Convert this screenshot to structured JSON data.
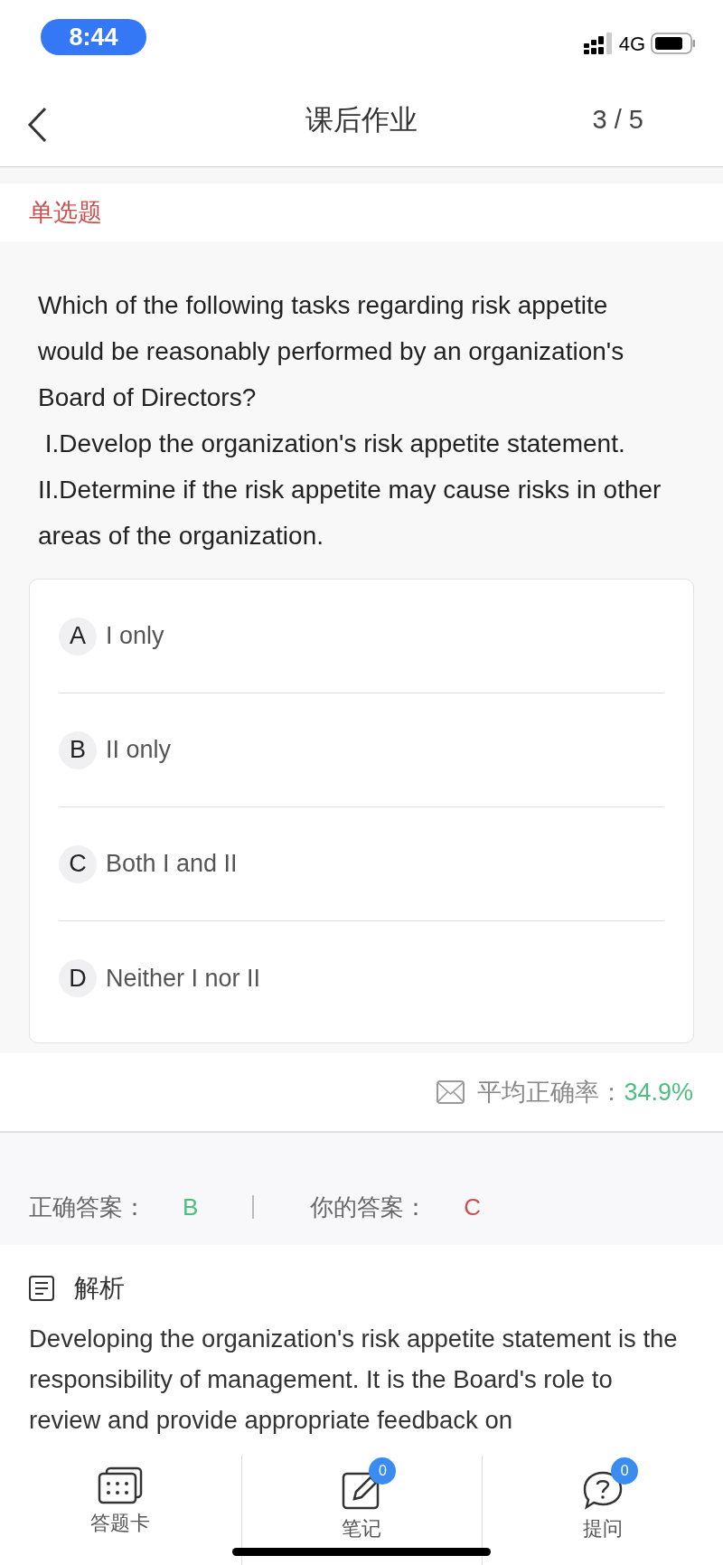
{
  "status_bar": {
    "time": "8:44",
    "network": "4G"
  },
  "nav": {
    "title": "课后作业",
    "progress": "3 / 5"
  },
  "question": {
    "type": "单选题",
    "text": [
      "Which of the following tasks regarding risk appetite would be reasonably performed by an organization's Board of Directors?",
      " I.Develop the organization's risk appetite statement.",
      "II.Determine if the risk appetite may cause risks in other areas of the organization."
    ],
    "options": [
      {
        "letter": "A",
        "text": "I only"
      },
      {
        "letter": "B",
        "text": "II only"
      },
      {
        "letter": "C",
        "text": "Both I and II"
      },
      {
        "letter": "D",
        "text": "Neither I nor II"
      }
    ]
  },
  "stats": {
    "label": "平均正确率：",
    "value": "34.9%"
  },
  "answers": {
    "correct_label": "正确答案：",
    "correct": "B",
    "yours_label": "你的答案：",
    "yours": "C"
  },
  "analysis": {
    "title": "解析",
    "text": "Developing the organization's risk appetite statement is the responsibility of management. It is the Board's role to review and provide appropriate feedback on"
  },
  "bottom_tabs": [
    {
      "label": "答题卡"
    },
    {
      "label": "笔记",
      "badge": "0"
    },
    {
      "label": "提问",
      "badge": "0"
    }
  ]
}
